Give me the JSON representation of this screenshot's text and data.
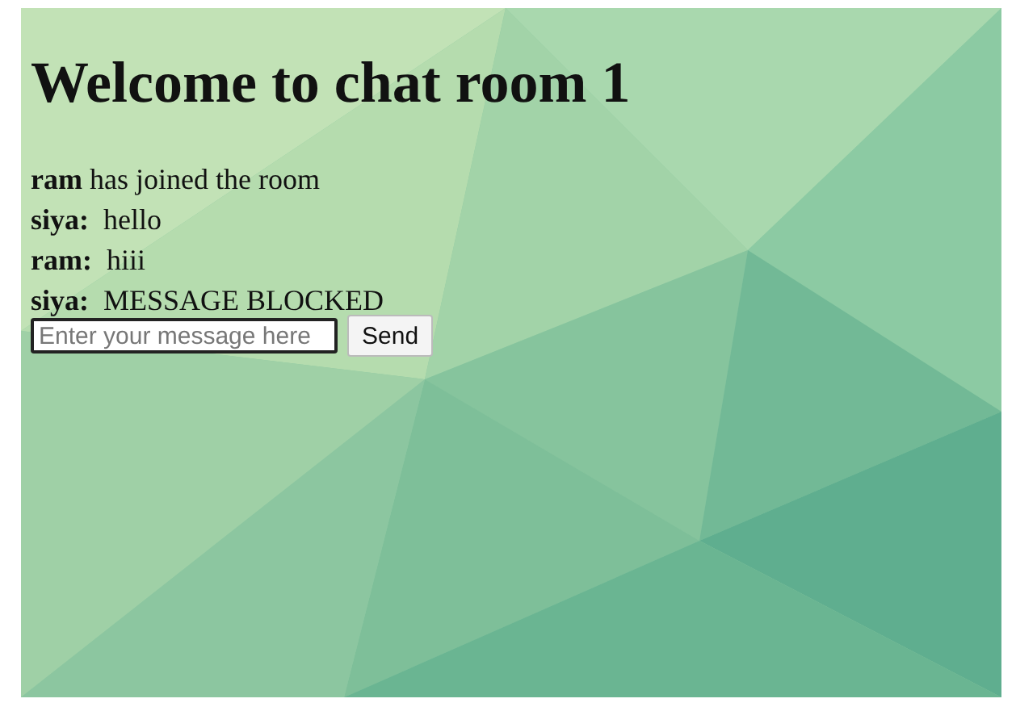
{
  "title": "Welcome to chat room 1",
  "messages": [
    {
      "kind": "join",
      "sender": "ram",
      "text": "has joined the room"
    },
    {
      "kind": "chat",
      "sender": "siya:",
      "text": "hello"
    },
    {
      "kind": "chat",
      "sender": "ram:",
      "text": "hiii"
    },
    {
      "kind": "chat",
      "sender": "siya:",
      "text": "MESSAGE BLOCKED"
    }
  ],
  "composer": {
    "placeholder": "Enter your message here",
    "focused": true,
    "button": "Send"
  }
}
